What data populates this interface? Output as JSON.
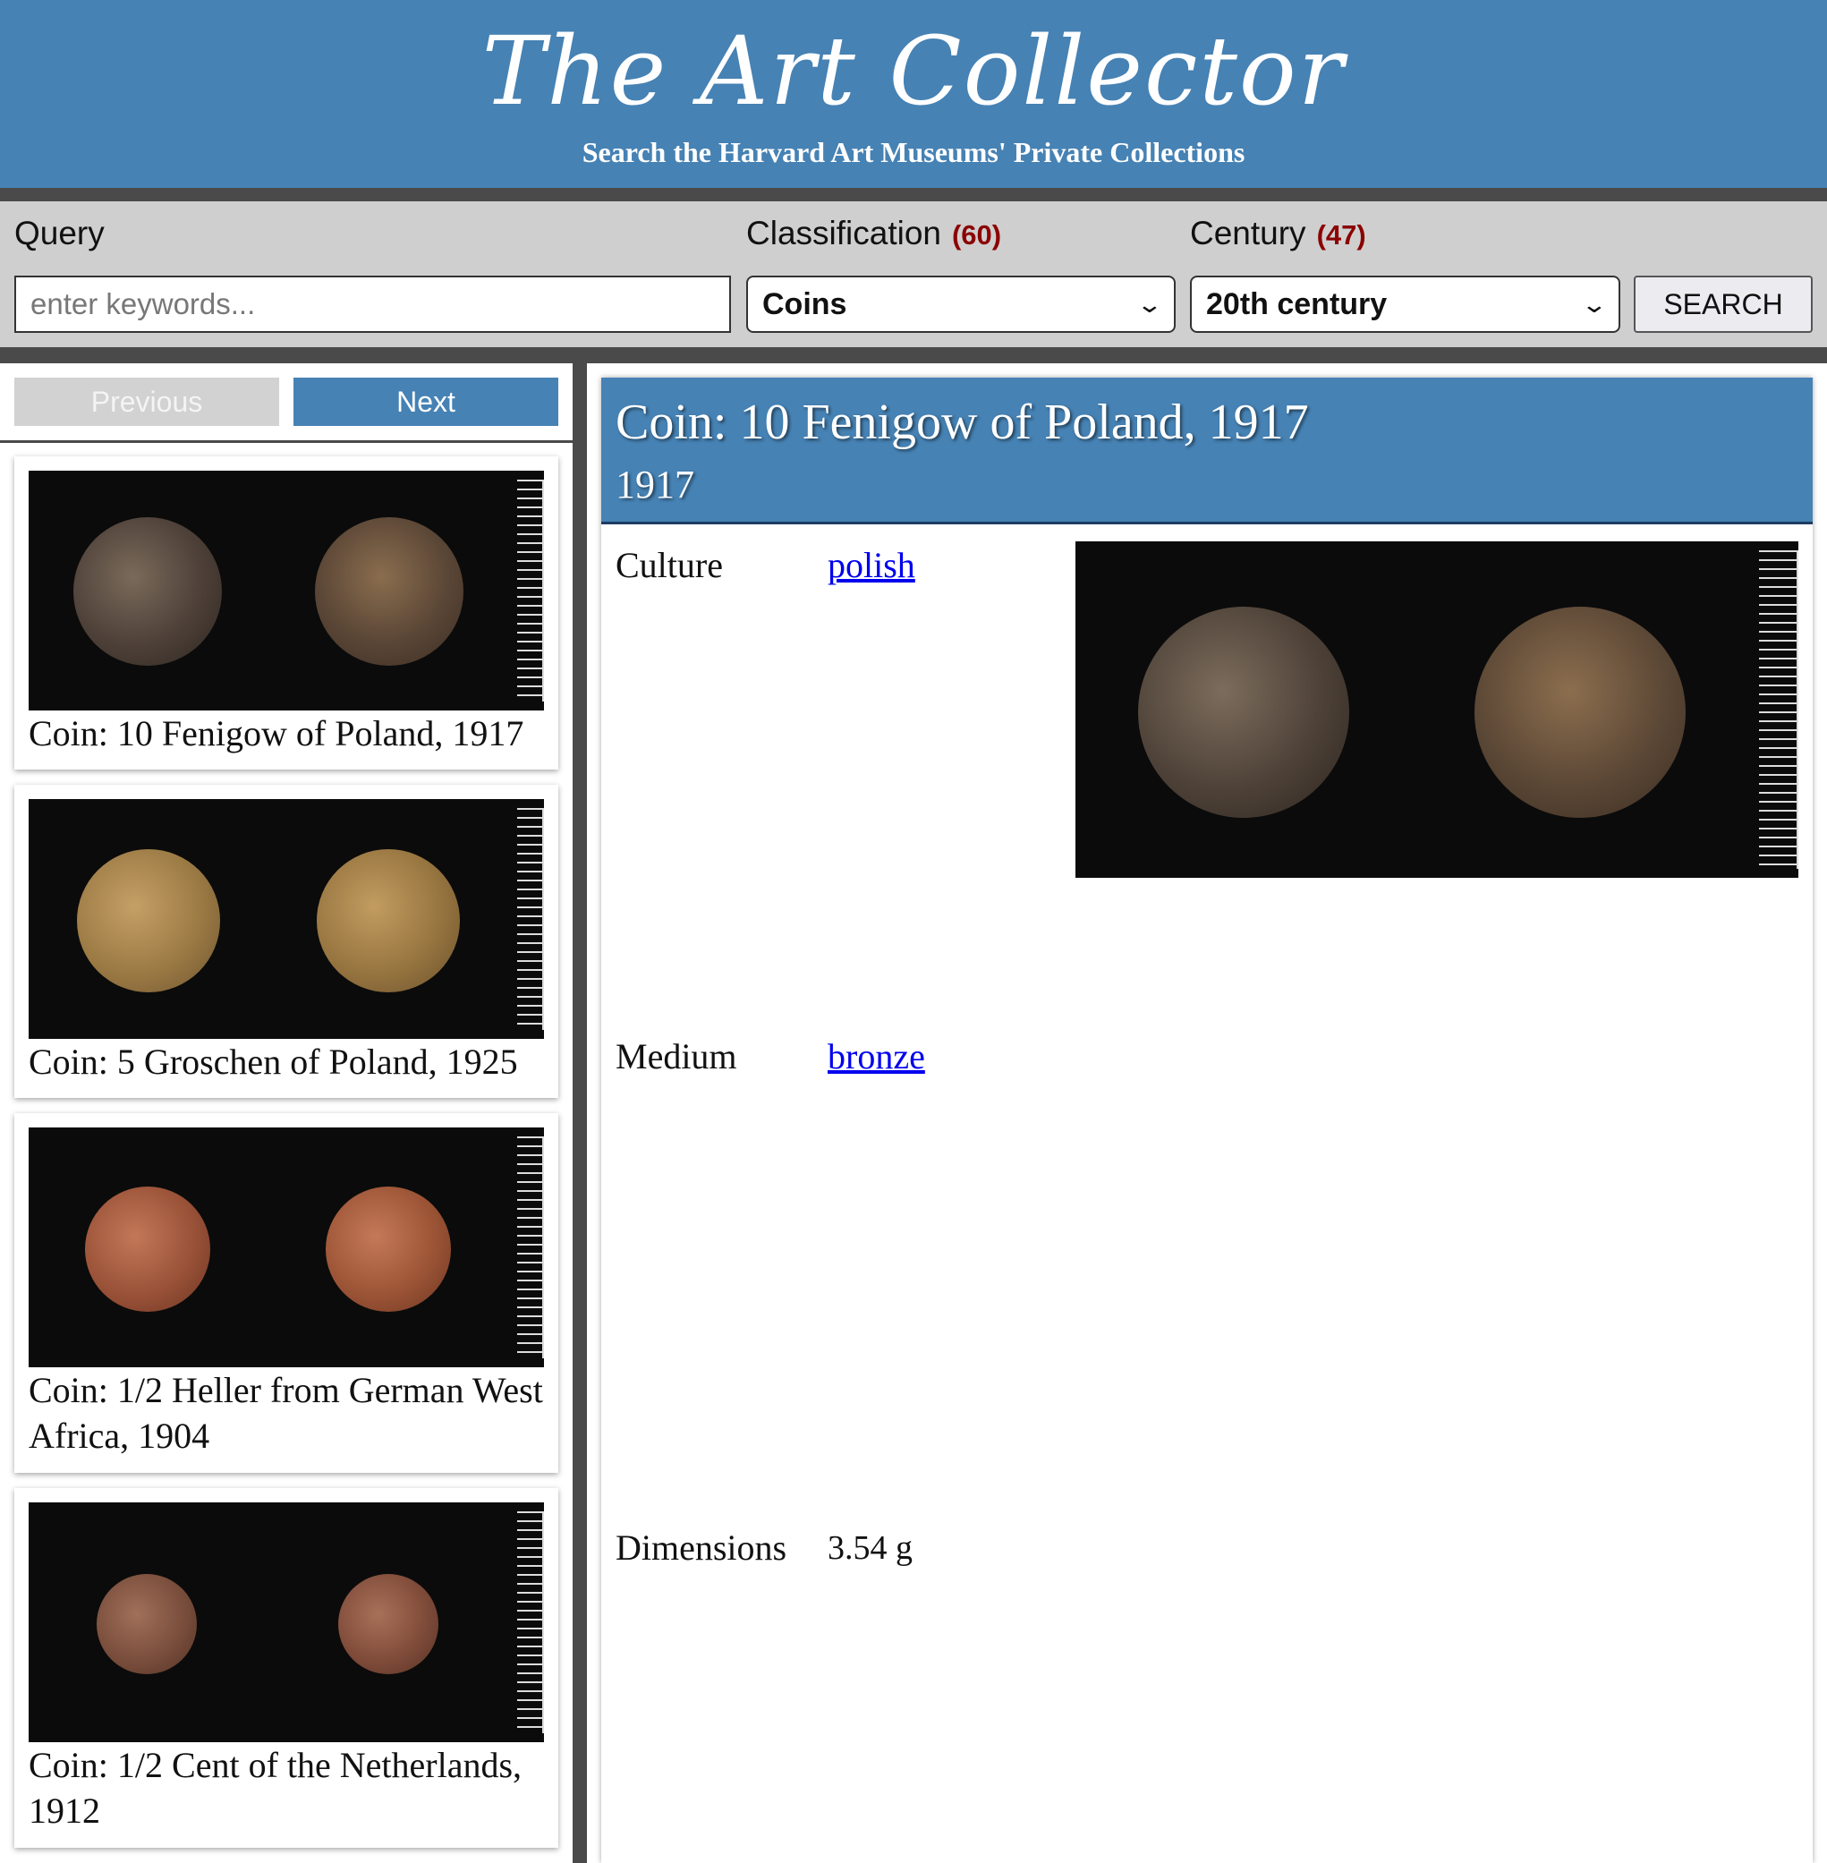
{
  "header": {
    "title": "The Art Collector",
    "subtitle": "Search the Harvard Art Museums' Private Collections"
  },
  "search": {
    "query_label": "Query",
    "query_placeholder": "enter keywords...",
    "classification_label": "Classification",
    "classification_count": "(60)",
    "classification_value": "Coins",
    "century_label": "Century",
    "century_count": "(47)",
    "century_value": "20th century",
    "button_label": "SEARCH"
  },
  "pagination": {
    "previous_label": "Previous",
    "next_label": "Next"
  },
  "results": [
    {
      "title": "Coin: 10 Fenigow of Poland, 1917"
    },
    {
      "title": "Coin: 5 Groschen of Poland, 1925"
    },
    {
      "title": "Coin: 1/2 Heller from German West Africa, 1904"
    },
    {
      "title": "Coin: 1/2 Cent of the Netherlands, 1912"
    }
  ],
  "detail": {
    "title": "Coin: 10 Fenigow of Poland, 1917",
    "date": "1917",
    "facts": [
      {
        "label": "Culture",
        "value": "polish"
      },
      {
        "label": "Medium",
        "value": "bronze"
      },
      {
        "label": "Dimensions",
        "value": "3.54 g"
      }
    ]
  },
  "colors": {
    "brand_blue": "#4682b4",
    "divider_gray": "#4a4a4a",
    "search_bg": "#cfcfcf",
    "count_red": "#8b0000",
    "link_blue": "#0000ee"
  }
}
